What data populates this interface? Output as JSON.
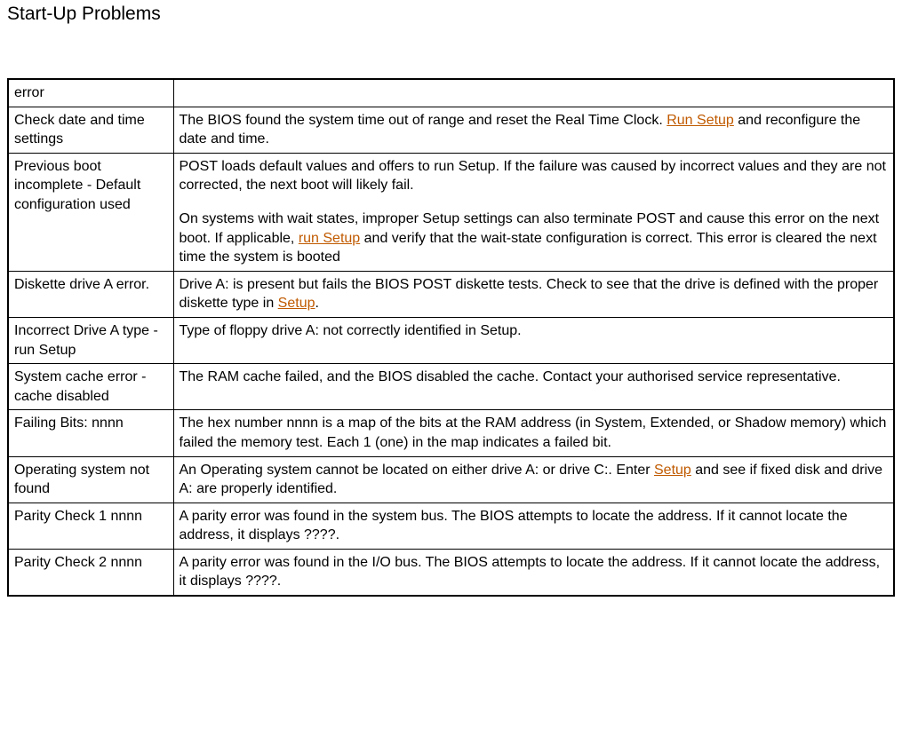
{
  "title": "Start-Up Problems",
  "links": {
    "run_setup": "Run Setup",
    "run_setup_lc": "run Setup",
    "setup": "Setup"
  },
  "rows": [
    {
      "left": "error",
      "right_parts": []
    },
    {
      "left": "Check date and time settings",
      "right_parts": [
        {
          "type": "text",
          "value": "The BIOS found the system time out of range and reset the Real Time Clock. "
        },
        {
          "type": "link",
          "key": "run_setup"
        },
        {
          "type": "text",
          "value": " and reconfigure the date and time."
        }
      ]
    },
    {
      "left": "Previous boot incomplete - Default configuration used",
      "right_paragraphs": [
        [
          {
            "type": "text",
            "value": "POST loads default values and offers to run Setup. If the failure was caused by incorrect values and they are not corrected, the next boot will likely fail."
          }
        ],
        [
          {
            "type": "text",
            "value": "On systems with wait states, improper Setup settings can also terminate POST and cause this error on the next boot. If applicable, "
          },
          {
            "type": "link",
            "key": "run_setup_lc"
          },
          {
            "type": "text",
            "value": " and verify that the wait-state configuration is correct. This error is cleared the next time the system is booted"
          }
        ]
      ]
    },
    {
      "left": "Diskette drive A error.",
      "right_parts": [
        {
          "type": "text",
          "value": "Drive A: is present but fails the BIOS POST diskette tests. Check to see that the drive is defined with the proper diskette type in "
        },
        {
          "type": "link",
          "key": "setup"
        },
        {
          "type": "text",
          "value": "."
        }
      ]
    },
    {
      "left": "Incorrect Drive A type - run Setup",
      "right_parts": [
        {
          "type": "text",
          "value": "Type of floppy drive A: not correctly identified in Setup."
        }
      ]
    },
    {
      "left": "System cache error - cache disabled",
      "right_parts": [
        {
          "type": "text",
          "value": "The RAM cache failed, and the BIOS disabled the cache. Contact your authorised service representative."
        }
      ]
    },
    {
      "left": "Failing Bits: nnnn",
      "right_parts": [
        {
          "type": "text",
          "value": "The hex number nnnn is a map of the bits at the RAM address (in System, Extended, or Shadow memory) which failed the memory test. Each 1 (one) in the map indicates a failed bit."
        }
      ]
    },
    {
      "left": "Operating system not found",
      "right_parts": [
        {
          "type": "text",
          "value": "An Operating system cannot be located on either drive A: or drive C:. Enter "
        },
        {
          "type": "link",
          "key": "setup"
        },
        {
          "type": "text",
          "value": " and see if fixed disk and drive A: are properly identified."
        }
      ]
    },
    {
      "left": "Parity Check 1 nnnn",
      "right_parts": [
        {
          "type": "text",
          "value": "A parity error was found in the system bus. The BIOS attempts to locate the address. If it cannot locate the address, it displays ????."
        }
      ]
    },
    {
      "left": "Parity Check 2 nnnn",
      "right_parts": [
        {
          "type": "text",
          "value": "A parity error was found in the I/O bus. The BIOS attempts to locate the address. If it cannot locate the address, it displays ????."
        }
      ]
    }
  ]
}
